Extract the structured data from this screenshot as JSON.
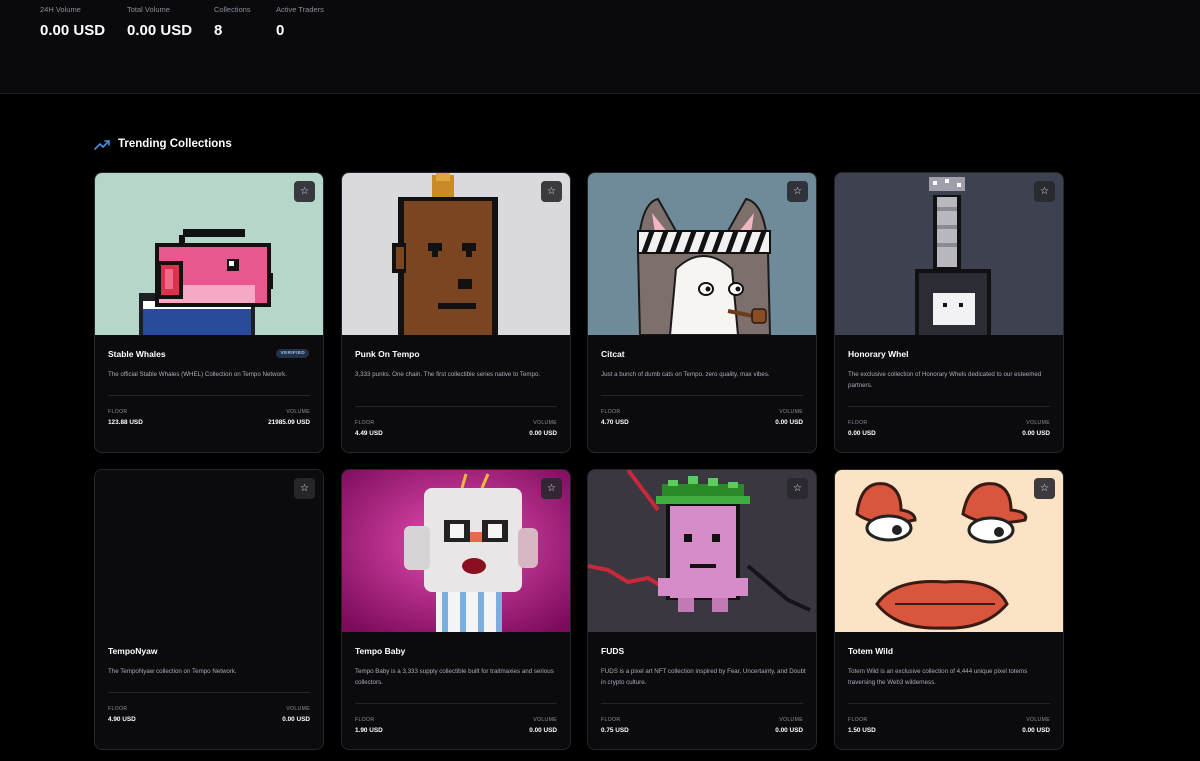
{
  "stats": {
    "volume_24h_label": "24H Volume",
    "volume_24h_value": "0.00 USD",
    "total_volume_label": "Total Volume",
    "total_volume_value": "0.00 USD",
    "collections_label": "Collections",
    "collections_value": "8",
    "active_traders_label": "Active Traders",
    "active_traders_value": "0"
  },
  "section": {
    "title": "Trending Collections",
    "icon": "trending-up-icon"
  },
  "accent_color": "#4a90d9",
  "favorite_icon": "star-icon",
  "collections": [
    {
      "name": "Stable Whales",
      "badge": "VERIFIED",
      "description": "The official Stable Whales (WHEL) Collection on Tempo Network.",
      "floor_label": "FLOOR",
      "floor": "123.88 USD",
      "volume_label": "VOLUME",
      "volume": "21985.09 USD",
      "bg": "#b5d6c8"
    },
    {
      "name": "Punk On Tempo",
      "description": "3,333 punks. One chain. The first collectible series native to Tempo.",
      "floor_label": "FLOOR",
      "floor": "4.49 USD",
      "volume_label": "VOLUME",
      "volume": "0.00 USD",
      "bg": "#d9d9de"
    },
    {
      "name": "Citcat",
      "description": "Just a bunch of dumb cats on Tempo. zero quality, max vibes.",
      "floor_label": "FLOOR",
      "floor": "4.70 USD",
      "volume_label": "VOLUME",
      "volume": "0.00 USD",
      "bg": "#6f8a99"
    },
    {
      "name": "Honorary Whel",
      "description": "The exclusive collection of Honorary Whels dedicated to our esteemed partners.",
      "floor_label": "FLOOR",
      "floor": "0.00 USD",
      "volume_label": "VOLUME",
      "volume": "0.00 USD",
      "bg": "#3d4150"
    },
    {
      "name": "TempoNyaw",
      "description": "The TempoNyaw collection on Tempo Network.",
      "floor_label": "FLOOR",
      "floor": "4.90 USD",
      "volume_label": "VOLUME",
      "volume": "0.00 USD",
      "bg": "#0b0b0e"
    },
    {
      "name": "Tempo Baby",
      "description": "Tempo Baby is a 3,333 supply collectible built for traitmaxies and serious collectors.",
      "floor_label": "FLOOR",
      "floor": "1.90 USD",
      "volume_label": "VOLUME",
      "volume": "0.00 USD",
      "bg": "#b0157f"
    },
    {
      "name": "FUDS",
      "description": "FUDS is a pixel art NFT collection inspired by Fear, Uncertainty, and Doubt in crypto culture.",
      "floor_label": "FLOOR",
      "floor": "0.75 USD",
      "volume_label": "VOLUME",
      "volume": "0.00 USD",
      "bg": "#3a3740"
    },
    {
      "name": "Totem Wild",
      "description": "Totem Wild is an exclusive collection of 4,444 unique pixel totems traversing the Web3 wilderness.",
      "floor_label": "FLOOR",
      "floor": "1.50 USD",
      "volume_label": "VOLUME",
      "volume": "0.00 USD",
      "bg": "#fbe3c5"
    }
  ]
}
